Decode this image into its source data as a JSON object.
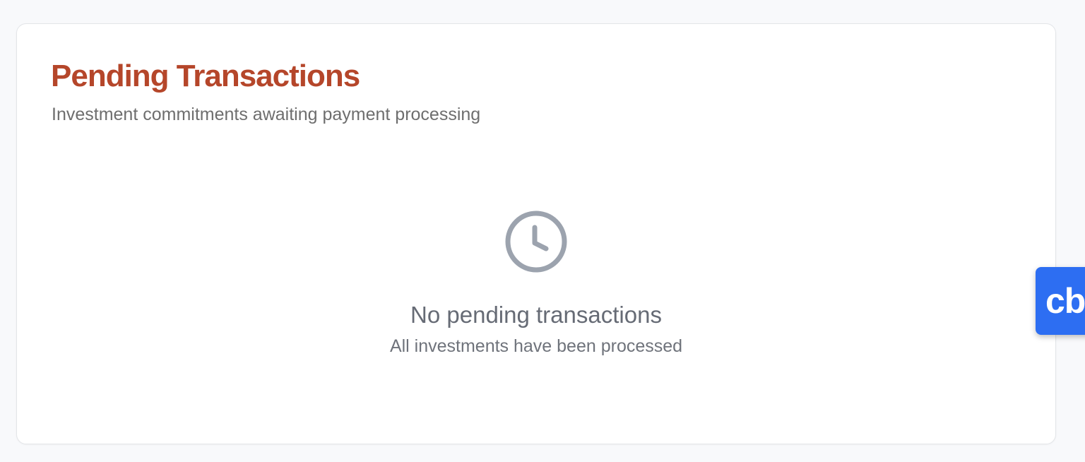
{
  "card": {
    "title": "Pending Transactions",
    "subtitle": "Investment commitments awaiting payment processing"
  },
  "empty_state": {
    "icon": "clock-icon",
    "title": "No pending transactions",
    "subtitle": "All investments have been processed"
  },
  "floating_widget": {
    "label": "cb"
  },
  "colors": {
    "title": "#b5462a",
    "widget": "#2d6ef2",
    "icon": "#9ca3ae",
    "background": "#f8f9fb"
  }
}
